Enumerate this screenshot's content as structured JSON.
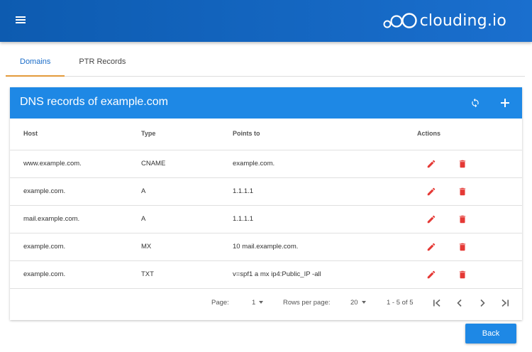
{
  "header": {
    "menu_icon": "hamburger-menu-icon",
    "logo_text": "clouding.io",
    "logo_icon": "clouding-logo-mark"
  },
  "tabs": [
    {
      "label": "Domains",
      "active": true
    },
    {
      "label": "PTR Records",
      "active": false
    }
  ],
  "card": {
    "title": "DNS records of example.com",
    "refresh_icon": "refresh-icon",
    "add_icon": "plus-icon"
  },
  "table": {
    "headers": {
      "host": "Host",
      "type": "Type",
      "points_to": "Points to",
      "actions": "Actions"
    },
    "rows": [
      {
        "host": "www.example.com.",
        "type": "CNAME",
        "points_to": "example.com."
      },
      {
        "host": "example.com.",
        "type": "A",
        "points_to": "1.1.1.1"
      },
      {
        "host": "mail.example.com.",
        "type": "A",
        "points_to": "1.1.1.1"
      },
      {
        "host": "example.com.",
        "type": "MX",
        "points_to": "10 mail.example.com."
      },
      {
        "host": "example.com.",
        "type": "TXT",
        "points_to": "v=spf1 a mx ip4:Public_IP -all"
      }
    ],
    "edit_icon": "pencil-icon",
    "delete_icon": "trash-icon"
  },
  "pagination": {
    "page_label": "Page:",
    "page_value": "1",
    "rows_label": "Rows per page:",
    "rows_value": "20",
    "range": "1 - 5 of 5"
  },
  "footer": {
    "back_label": "Back"
  },
  "colors": {
    "topbar": "#1a6fce",
    "card_header": "#1e88e5",
    "active_tab_text": "#1a6cc8",
    "active_tab_indicator": "#e39a3b",
    "action_icons": "#e53935"
  }
}
